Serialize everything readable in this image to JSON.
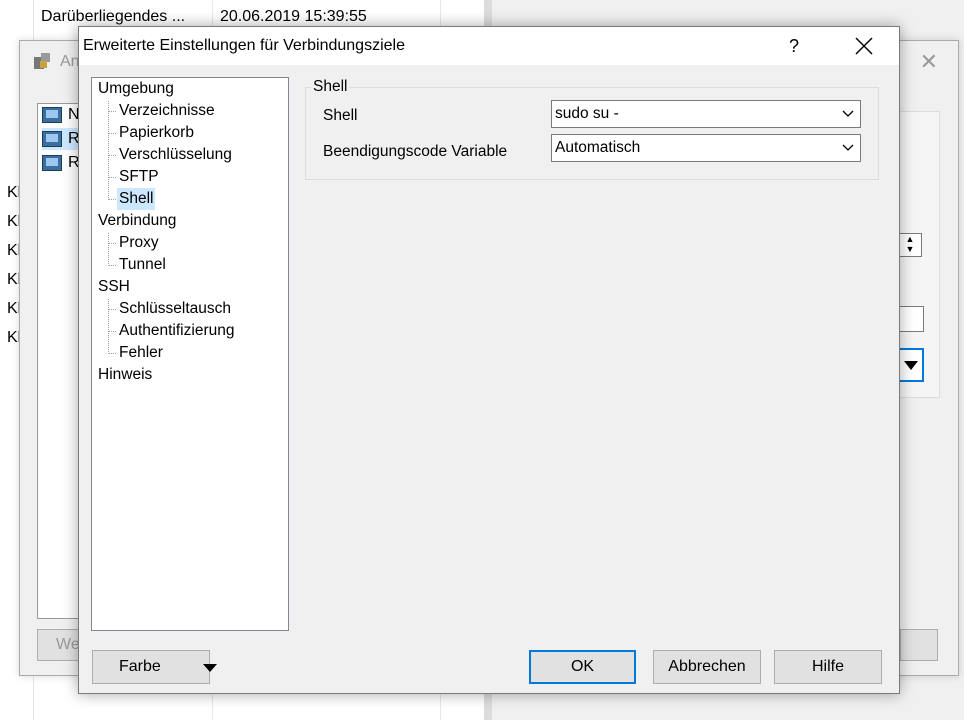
{
  "background": {
    "row_name": "Darüberliegendes ...",
    "row_date": "20.06.2019  15:39:55",
    "left_items": [
      "Kl",
      "Kl",
      "Kl",
      "Kl",
      "Kl",
      "Kl"
    ],
    "login_dialog": {
      "title": "An",
      "sites": [
        "N",
        "R",
        "R"
      ],
      "left_button": "We"
    }
  },
  "dialog": {
    "title": "Erweiterte Einstellungen für Verbindungsziele",
    "help": "?",
    "tree": [
      {
        "label": "Umgebung",
        "level": 0
      },
      {
        "label": "Verzeichnisse",
        "level": 1
      },
      {
        "label": "Papierkorb",
        "level": 1
      },
      {
        "label": "Verschlüsselung",
        "level": 1
      },
      {
        "label": "SFTP",
        "level": 1
      },
      {
        "label": "Shell",
        "level": 1,
        "selected": true
      },
      {
        "label": "Verbindung",
        "level": 0
      },
      {
        "label": "Proxy",
        "level": 1
      },
      {
        "label": "Tunnel",
        "level": 1
      },
      {
        "label": "SSH",
        "level": 0
      },
      {
        "label": "Schlüsseltausch",
        "level": 1
      },
      {
        "label": "Authentifizierung",
        "level": 1
      },
      {
        "label": "Fehler",
        "level": 1
      },
      {
        "label": "Hinweis",
        "level": 0
      }
    ],
    "group_title": "Shell",
    "shell_label": "Shell",
    "shell_value": "sudo su -",
    "exit_code_label": "Beendigungscode Variable",
    "exit_code_value": "Automatisch",
    "buttons": {
      "color": "Farbe",
      "ok": "OK",
      "cancel": "Abbrechen",
      "help": "Hilfe"
    }
  }
}
